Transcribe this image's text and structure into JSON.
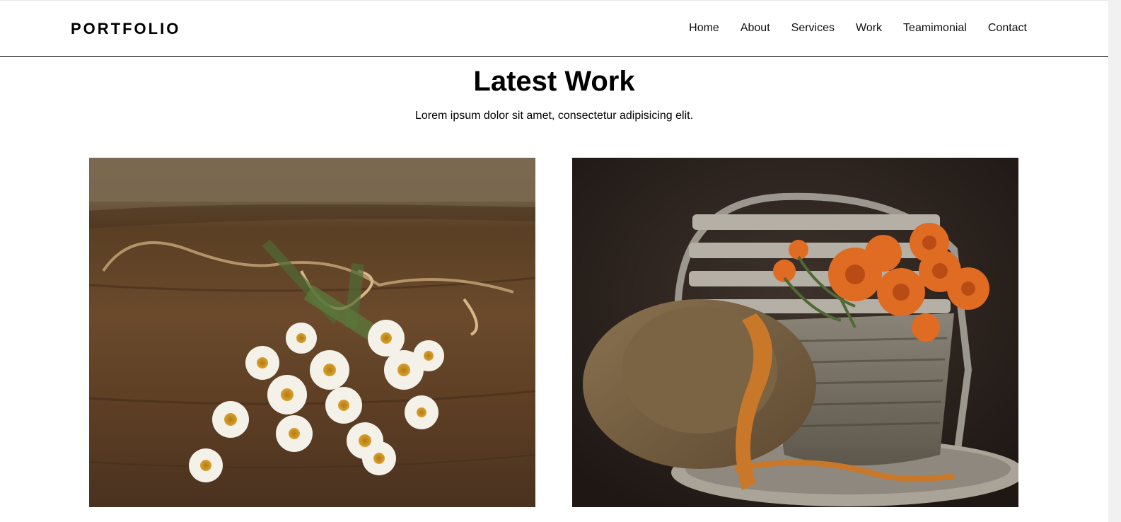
{
  "header": {
    "logo": "PORTFOLIO",
    "nav": [
      {
        "label": "Home"
      },
      {
        "label": "About"
      },
      {
        "label": "Services"
      },
      {
        "label": "Work"
      },
      {
        "label": "Teamimonial"
      },
      {
        "label": "Contact"
      }
    ]
  },
  "section": {
    "title": "Latest Work",
    "subtitle": "Lorem ipsum dolor sit amet, consectetur adipisicing elit."
  },
  "gallery": {
    "items": [
      {
        "image": "white-daisy-bouquet-on-wooden-table"
      },
      {
        "image": "orange-ranunculus-in-wicker-basket-with-straw-hat"
      }
    ]
  },
  "colors": {
    "text": "#000000",
    "border": "#000000",
    "background": "#ffffff"
  }
}
